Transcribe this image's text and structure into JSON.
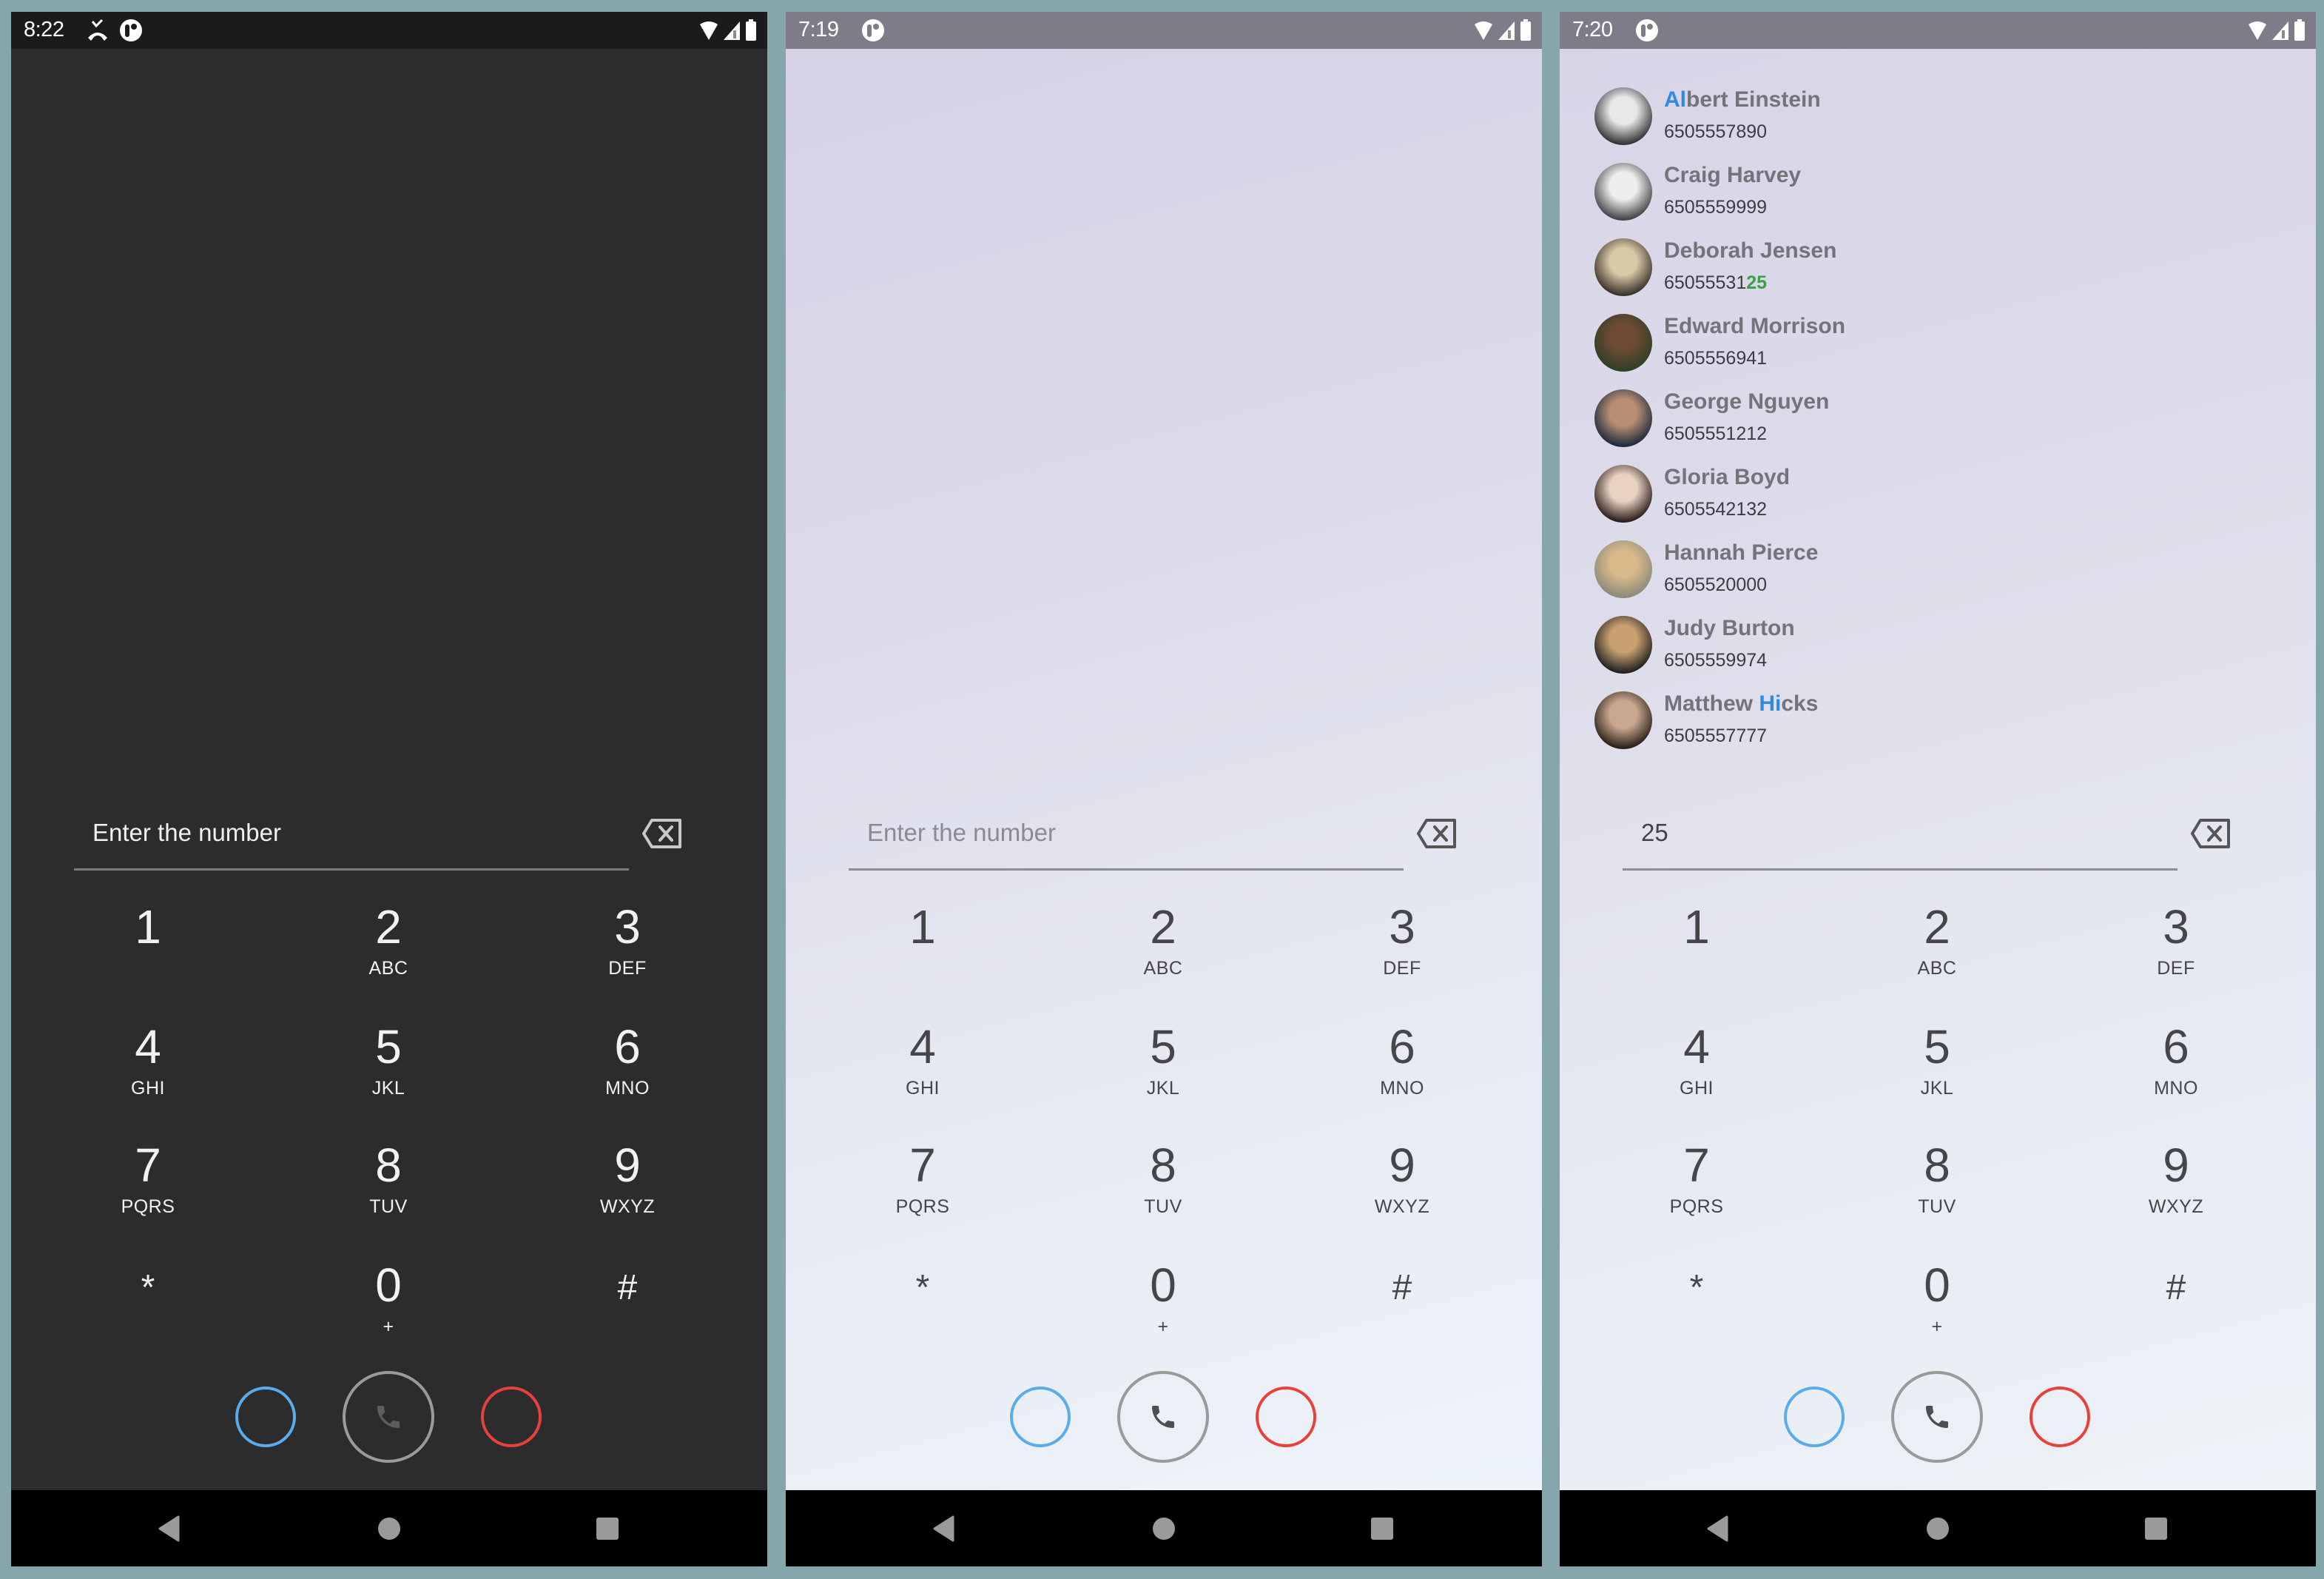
{
  "colors": {
    "background": "#85a6ab",
    "dark_panel": "#2c2c2c",
    "blue_ring": "#5aabec",
    "red_ring": "#e8403a",
    "call_ring": "#9a9a9a",
    "name_highlight": "#2f8ae0",
    "number_highlight": "#3aa047"
  },
  "screens": [
    {
      "theme": "dark",
      "status_bar": {
        "time": "8:22",
        "icons": [
          "missed-call-icon",
          "app-notification-icon",
          "wifi-icon",
          "signal-icon",
          "battery-icon"
        ]
      },
      "input": {
        "value": "",
        "placeholder": "Enter the number"
      }
    },
    {
      "theme": "light",
      "status_bar": {
        "time": "7:19",
        "icons": [
          "app-notification-icon",
          "wifi-icon",
          "signal-icon",
          "battery-icon"
        ]
      },
      "input": {
        "value": "",
        "placeholder": "Enter the number"
      }
    },
    {
      "theme": "light",
      "status_bar": {
        "time": "7:20",
        "icons": [
          "app-notification-icon",
          "wifi-icon",
          "signal-icon",
          "battery-icon"
        ]
      },
      "input": {
        "value": "25",
        "placeholder": "Enter the number"
      },
      "contacts": [
        {
          "name_pre": "",
          "name_hl": "Al",
          "name_post": "bert Einstein",
          "phone_pre": "6505557890",
          "phone_hl": ""
        },
        {
          "name_pre": "Craig Harvey",
          "name_hl": "",
          "name_post": "",
          "phone_pre": "6505559999",
          "phone_hl": ""
        },
        {
          "name_pre": "Deborah Jensen",
          "name_hl": "",
          "name_post": "",
          "phone_pre": "65055531",
          "phone_hl": "25"
        },
        {
          "name_pre": "Edward Morrison",
          "name_hl": "",
          "name_post": "",
          "phone_pre": "6505556941",
          "phone_hl": ""
        },
        {
          "name_pre": "George Nguyen",
          "name_hl": "",
          "name_post": "",
          "phone_pre": "6505551212",
          "phone_hl": ""
        },
        {
          "name_pre": "Gloria Boyd",
          "name_hl": "",
          "name_post": "",
          "phone_pre": "6505542132",
          "phone_hl": ""
        },
        {
          "name_pre": "Hannah Pierce",
          "name_hl": "",
          "name_post": "",
          "phone_pre": "6505520000",
          "phone_hl": ""
        },
        {
          "name_pre": "Judy Burton",
          "name_hl": "",
          "name_post": "",
          "phone_pre": "6505559974",
          "phone_hl": ""
        },
        {
          "name_pre": "Matthew ",
          "name_hl": "Hi",
          "name_post": "cks",
          "phone_pre": "6505557777",
          "phone_hl": ""
        }
      ]
    }
  ],
  "keypad": [
    {
      "digit": "1",
      "letters": ""
    },
    {
      "digit": "2",
      "letters": "ABC"
    },
    {
      "digit": "3",
      "letters": "DEF"
    },
    {
      "digit": "4",
      "letters": "GHI"
    },
    {
      "digit": "5",
      "letters": "JKL"
    },
    {
      "digit": "6",
      "letters": "MNO"
    },
    {
      "digit": "7",
      "letters": "PQRS"
    },
    {
      "digit": "8",
      "letters": "TUV"
    },
    {
      "digit": "9",
      "letters": "WXYZ"
    },
    {
      "digit": "*",
      "letters": ""
    },
    {
      "digit": "0",
      "letters": "+"
    },
    {
      "digit": "#",
      "letters": ""
    }
  ],
  "actions": {
    "left_button": "blue-circle-button",
    "call_button": "phone-icon",
    "right_button": "red-circle-button"
  },
  "nav": [
    "back-icon",
    "home-icon",
    "recents-icon"
  ]
}
